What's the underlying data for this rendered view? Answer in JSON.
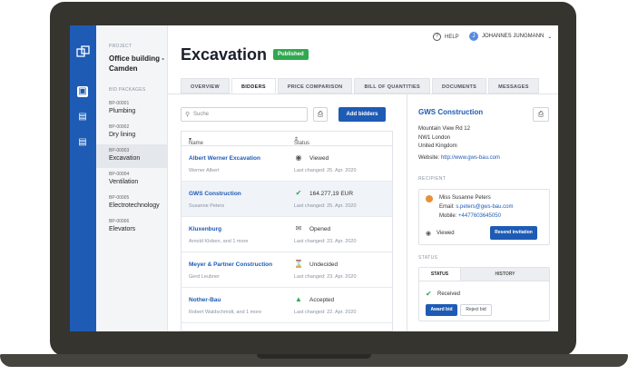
{
  "header": {
    "help": "HELP",
    "user": "JOHANNES JUNGMANN",
    "user_initial": "J"
  },
  "sidebar": {
    "project_label": "PROJECT",
    "project_name": "Office building - Camden",
    "bid_packages_label": "BID PACKAGES",
    "packages": [
      {
        "code": "BP-00001",
        "name": "Plumbing"
      },
      {
        "code": "BP-00002",
        "name": "Dry lining"
      },
      {
        "code": "BP-00003",
        "name": "Excavation"
      },
      {
        "code": "BP-00004",
        "name": "Ventilation"
      },
      {
        "code": "BP-00005",
        "name": "Electrotechnology"
      },
      {
        "code": "BP-00006",
        "name": "Elevators"
      }
    ]
  },
  "page": {
    "title": "Excavation",
    "status_badge": "Published"
  },
  "tabs": [
    "OVERVIEW",
    "BIDDERS",
    "PRICE COMPARISON",
    "BILL OF QUANTITIES",
    "DOCUMENTS",
    "MESSAGES"
  ],
  "bidders": {
    "search_placeholder": "Suche",
    "add_label": "Add bidders",
    "col_name": "Name",
    "col_status": "Status",
    "rows": [
      {
        "name": "Albert Werner Excavation",
        "contact": "Werner Albert",
        "status": "Viewed",
        "changed": "Last changed: 25. Apr. 2020",
        "icon": "eye-icon"
      },
      {
        "name": "GWS Construction",
        "contact": "Susanne Peters",
        "status": "164.277,19 EUR",
        "changed": "Last changed: 25. Apr. 2020",
        "icon": "check-circle-icon"
      },
      {
        "name": "Kluxenburg",
        "contact": "Arnold Kloben, and 1 more",
        "status": "Opened",
        "changed": "Last changed: 23. Apr. 2020",
        "icon": "envelope-open-icon"
      },
      {
        "name": "Meyer & Partner Construction",
        "contact": "Gerd Leubner",
        "status": "Undecided",
        "changed": "Last changed: 23. Apr. 2020",
        "icon": "hourglass-icon"
      },
      {
        "name": "Nother-Bau",
        "contact": "Robert Waldschmidt, and 1 more",
        "status": "Accepted",
        "changed": "Last changed: 22. Apr. 2020",
        "icon": "thumbs-up-icon"
      }
    ]
  },
  "detail": {
    "name": "GWS Construction",
    "address": [
      "Mountain View Rd 12",
      "NW1 London",
      "United Kingdom"
    ],
    "website_label": "Website:",
    "website": "http://www.gws-bau.com",
    "recipient_label": "RECIPIENT",
    "recipient_name": "Miss Susanne Peters",
    "email_label": "Email:",
    "email": "s.peters@gws-bau.com",
    "mobile_label": "Mobile:",
    "mobile": "+4477603645050",
    "recipient_status": "Viewed",
    "resend_label": "Resend invitation",
    "status_label": "STATUS",
    "status_tab": "STATUS",
    "history_tab": "HISTORY",
    "received": "Received",
    "award_label": "Award bid",
    "reject_label": "Reject bid"
  },
  "colors": {
    "primary": "#1e5bb5",
    "success": "#2fa84f"
  }
}
